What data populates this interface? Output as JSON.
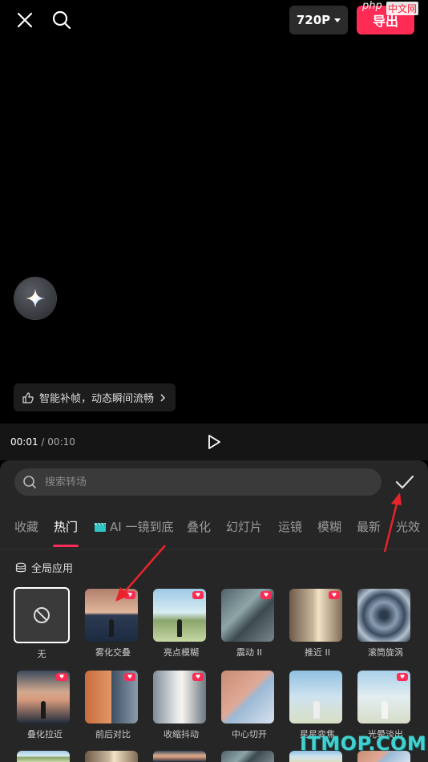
{
  "topbar": {
    "resolution": "720P",
    "export_label": "导出",
    "watermark_php": "php",
    "watermark_cn": "中文网"
  },
  "preview": {
    "ai_button_icon": "sparkle-icon",
    "hint_text": "智能补帧，动态瞬间流畅"
  },
  "timebar": {
    "current_time": "00:01",
    "separator": "/",
    "total_time": "00:10"
  },
  "panel": {
    "search_placeholder": "搜索转场",
    "tabs": [
      {
        "label": "收藏"
      },
      {
        "label": "热门"
      },
      {
        "label": "AI 一镜到底"
      },
      {
        "label": "叠化"
      },
      {
        "label": "幻灯片"
      },
      {
        "label": "运镜"
      },
      {
        "label": "模糊"
      },
      {
        "label": "最新"
      },
      {
        "label": "光效"
      }
    ],
    "active_tab": "热门",
    "apply_all_label": "全局应用",
    "items": [
      {
        "label": "无"
      },
      {
        "label": "雾化交叠"
      },
      {
        "label": "亮点模糊"
      },
      {
        "label": "震动 II"
      },
      {
        "label": "推近 II"
      },
      {
        "label": "滚筒旋涡"
      },
      {
        "label": "叠化拉近"
      },
      {
        "label": "前后对比"
      },
      {
        "label": "收缩抖动"
      },
      {
        "label": "中心切开"
      },
      {
        "label": "星星变焦"
      },
      {
        "label": "光晕淡出"
      }
    ]
  },
  "watermark_footer": "ITMOP.COM",
  "colors": {
    "accent": "#fe2c55",
    "background": "#000000",
    "panel": "#262626"
  }
}
